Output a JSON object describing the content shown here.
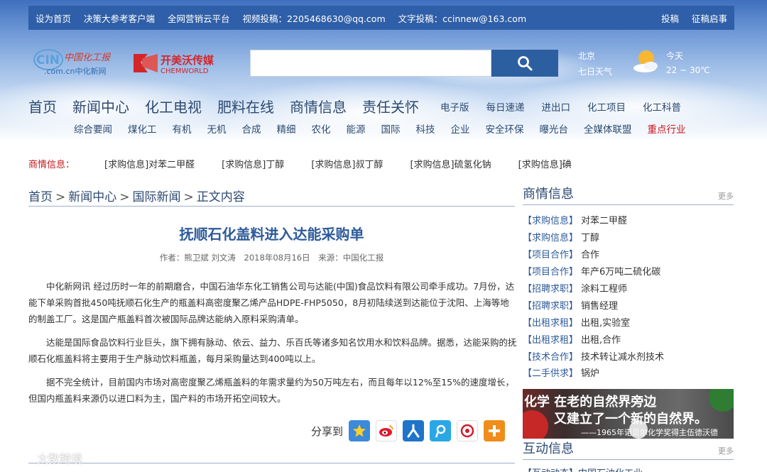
{
  "topbar": {
    "left_links": [
      "设为首页",
      "决策大参考客户端",
      "全网营销云平台",
      "视频投稿：2205468630@qq.com",
      "文字投稿：ccinnew@163.com"
    ],
    "right_links": [
      "投稿",
      "征稿启事"
    ]
  },
  "header": {
    "logo_main": "中国化工报",
    "logo_main_url": ".com.cn中化新网",
    "logo_partner": "开美沃传媒",
    "logo_partner_en": "CHEMWORLD",
    "search_placeholder": "",
    "weather": {
      "city": "北京",
      "forecast_link": "七日天气",
      "day": "今天",
      "temp": "22 ~ 30℃"
    }
  },
  "nav": {
    "main": [
      "首页",
      "新闻中心",
      "化工电视",
      "肥料在线",
      "商情信息",
      "责任关怀"
    ],
    "small": [
      "电子版",
      "每日速递",
      "进出口",
      "化工项目",
      "化工科普"
    ],
    "sub": [
      "综合要闻",
      "煤化工",
      "有机",
      "无机",
      "合成",
      "精细",
      "农化",
      "能源",
      "国际",
      "科技",
      "企业",
      "安全环保",
      "曝光台",
      "全媒体联盟"
    ],
    "sub_hot": "重点行业"
  },
  "ticker": {
    "label": "商情信息：",
    "items": [
      "[求购信息]对苯二甲醛",
      "[求购信息]丁醇",
      "[求购信息]叔丁醇",
      "[求购信息]硫氢化钠",
      "[求购信息]碘"
    ]
  },
  "breadcrumb": [
    "首页",
    "新闻中心",
    "国际新闻",
    "正文内容"
  ],
  "breadcrumb_sep": ">",
  "article": {
    "title": "抚顺石化盖料进入达能采购单",
    "author": "作者：熊卫斌 刘文涛",
    "date": "2018年08月16日",
    "source": "来源：中国化工报",
    "paragraphs": [
      "中化新网讯 经过历时一年的前期磨合，中国石油华东化工销售公司与达能(中国)食品饮料有限公司牵手成功。7月份，达能下单采购首批450吨抚顺石化生产的瓶盖料高密度聚乙烯产品HDPE-FHP5050，8月初陆续送到达能位于沈阳、上海等地的制盖工厂。这是国产瓶盖料首次被国际品牌达能纳入原料采购清单。",
      "达能是国际食品饮料行业巨头，旗下拥有脉动、依云、益力、乐百氏等诸多知名饮用水和饮料品牌。据悉，达能采购的抚顺石化瓶盖料将主要用于生产脉动饮料瓶盖，每月采购量达到400吨以上。",
      "据不完全统计，目前国内市场对高密度聚乙烯瓶盖料的年需求量约为50万吨左右，而且每年以12%至15%的速度增长，但国内瓶盖料来源仍以进口料为主，国产料的市场开拓空间较大。"
    ],
    "share_label": "分享到"
  },
  "sidebar": {
    "market": {
      "title": "商情信息",
      "more": "更多",
      "items": [
        {
          "tag": "【求购信息】",
          "text": "对苯二甲醛"
        },
        {
          "tag": "【求购信息】",
          "text": "丁醇"
        },
        {
          "tag": "【项目合作】",
          "text": "合作"
        },
        {
          "tag": "【项目合作】",
          "text": "年产6万吨二硫化碳"
        },
        {
          "tag": "【招聘求职】",
          "text": "涂料工程师"
        },
        {
          "tag": "【招聘求职】",
          "text": "销售经理"
        },
        {
          "tag": "【出租求租】",
          "text": "出租,实验室"
        },
        {
          "tag": "【出租求租】",
          "text": "出租,合作"
        },
        {
          "tag": "【技术合作】",
          "text": "技术转让减水剂技术"
        },
        {
          "tag": "【二手供求】",
          "text": "锅炉"
        }
      ]
    },
    "banner": {
      "line1": "化学 在老的自然界旁边",
      "line2": "又建立了一个新的自然界。",
      "line3": "——1965年诺贝尔化学奖得主伍德沃德"
    },
    "interactive": {
      "title": "互动信息",
      "more": "更多",
      "peek": "【互动动态】中国石油化工业"
    }
  },
  "watermark": "大数跨境",
  "colors": {
    "brand_blue": "#2f5fa8",
    "title_blue": "#2d5a9a",
    "nav_text": "#2c4a72",
    "hot_red": "#c8161d"
  }
}
